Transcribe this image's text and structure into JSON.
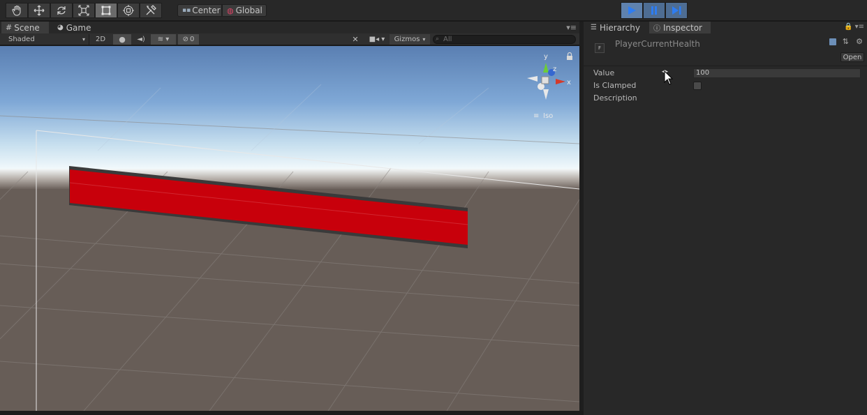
{
  "toolbar": {
    "tools": [
      {
        "icon": "hand-icon",
        "active": false
      },
      {
        "icon": "move-icon",
        "active": false
      },
      {
        "icon": "rotate-icon",
        "active": false
      },
      {
        "icon": "scale-icon",
        "active": false
      },
      {
        "icon": "rect-icon",
        "active": true
      },
      {
        "icon": "transform-icon",
        "active": false
      },
      {
        "icon": "custom-tool-icon",
        "active": false
      }
    ],
    "pivot_label": "Center",
    "space_label": "Global",
    "playback": [
      {
        "icon": "play-icon",
        "selected": true
      },
      {
        "icon": "pause-icon",
        "selected": false
      },
      {
        "icon": "step-icon",
        "selected": false
      }
    ]
  },
  "scene": {
    "tabs": [
      {
        "label": "Scene",
        "icon": "grid-icon",
        "active": true
      },
      {
        "label": "Game",
        "icon": "pacman-icon",
        "active": false
      }
    ],
    "shading_mode": "Shaded",
    "mode_2d": "2D",
    "hidden_count": "0",
    "gizmos_label": "Gizmos",
    "search_placeholder": "All",
    "projection_label": "Iso",
    "axes": {
      "y": "y",
      "z": "z",
      "x": "x"
    },
    "object_color": "#c8000b"
  },
  "inspector": {
    "tabs": [
      {
        "label": "Hierarchy",
        "icon": "hierarchy-icon",
        "active": false
      },
      {
        "label": "Inspector",
        "icon": "info-icon",
        "active": true
      }
    ],
    "asset_name": "PlayerCurrentHealth",
    "open_label": "Open",
    "properties": {
      "value_label": "Value",
      "value": "100",
      "is_clamped_label": "Is Clamped",
      "is_clamped": false,
      "description_label": "Description"
    }
  }
}
